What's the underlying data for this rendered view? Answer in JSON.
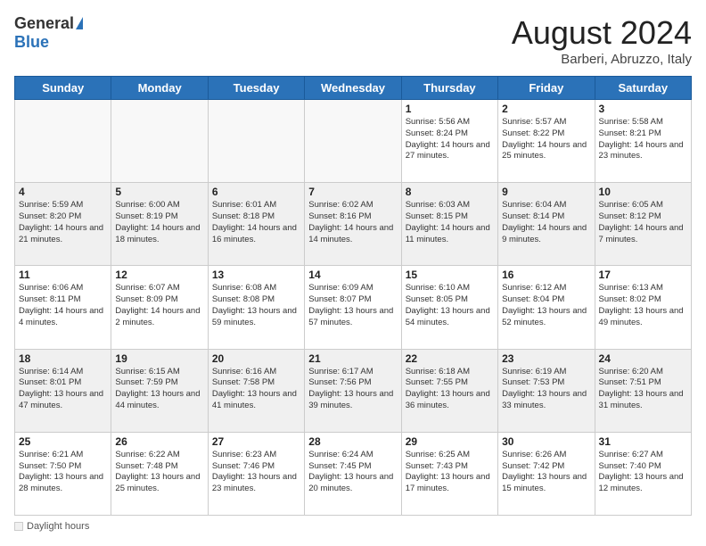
{
  "header": {
    "logo_general": "General",
    "logo_blue": "Blue",
    "month_title": "August 2024",
    "subtitle": "Barberi, Abruzzo, Italy"
  },
  "footer": {
    "label": "Daylight hours"
  },
  "weekdays": [
    "Sunday",
    "Monday",
    "Tuesday",
    "Wednesday",
    "Thursday",
    "Friday",
    "Saturday"
  ],
  "weeks": [
    [
      {
        "day": "",
        "info": ""
      },
      {
        "day": "",
        "info": ""
      },
      {
        "day": "",
        "info": ""
      },
      {
        "day": "",
        "info": ""
      },
      {
        "day": "1",
        "info": "Sunrise: 5:56 AM\nSunset: 8:24 PM\nDaylight: 14 hours and 27 minutes."
      },
      {
        "day": "2",
        "info": "Sunrise: 5:57 AM\nSunset: 8:22 PM\nDaylight: 14 hours and 25 minutes."
      },
      {
        "day": "3",
        "info": "Sunrise: 5:58 AM\nSunset: 8:21 PM\nDaylight: 14 hours and 23 minutes."
      }
    ],
    [
      {
        "day": "4",
        "info": "Sunrise: 5:59 AM\nSunset: 8:20 PM\nDaylight: 14 hours and 21 minutes."
      },
      {
        "day": "5",
        "info": "Sunrise: 6:00 AM\nSunset: 8:19 PM\nDaylight: 14 hours and 18 minutes."
      },
      {
        "day": "6",
        "info": "Sunrise: 6:01 AM\nSunset: 8:18 PM\nDaylight: 14 hours and 16 minutes."
      },
      {
        "day": "7",
        "info": "Sunrise: 6:02 AM\nSunset: 8:16 PM\nDaylight: 14 hours and 14 minutes."
      },
      {
        "day": "8",
        "info": "Sunrise: 6:03 AM\nSunset: 8:15 PM\nDaylight: 14 hours and 11 minutes."
      },
      {
        "day": "9",
        "info": "Sunrise: 6:04 AM\nSunset: 8:14 PM\nDaylight: 14 hours and 9 minutes."
      },
      {
        "day": "10",
        "info": "Sunrise: 6:05 AM\nSunset: 8:12 PM\nDaylight: 14 hours and 7 minutes."
      }
    ],
    [
      {
        "day": "11",
        "info": "Sunrise: 6:06 AM\nSunset: 8:11 PM\nDaylight: 14 hours and 4 minutes."
      },
      {
        "day": "12",
        "info": "Sunrise: 6:07 AM\nSunset: 8:09 PM\nDaylight: 14 hours and 2 minutes."
      },
      {
        "day": "13",
        "info": "Sunrise: 6:08 AM\nSunset: 8:08 PM\nDaylight: 13 hours and 59 minutes."
      },
      {
        "day": "14",
        "info": "Sunrise: 6:09 AM\nSunset: 8:07 PM\nDaylight: 13 hours and 57 minutes."
      },
      {
        "day": "15",
        "info": "Sunrise: 6:10 AM\nSunset: 8:05 PM\nDaylight: 13 hours and 54 minutes."
      },
      {
        "day": "16",
        "info": "Sunrise: 6:12 AM\nSunset: 8:04 PM\nDaylight: 13 hours and 52 minutes."
      },
      {
        "day": "17",
        "info": "Sunrise: 6:13 AM\nSunset: 8:02 PM\nDaylight: 13 hours and 49 minutes."
      }
    ],
    [
      {
        "day": "18",
        "info": "Sunrise: 6:14 AM\nSunset: 8:01 PM\nDaylight: 13 hours and 47 minutes."
      },
      {
        "day": "19",
        "info": "Sunrise: 6:15 AM\nSunset: 7:59 PM\nDaylight: 13 hours and 44 minutes."
      },
      {
        "day": "20",
        "info": "Sunrise: 6:16 AM\nSunset: 7:58 PM\nDaylight: 13 hours and 41 minutes."
      },
      {
        "day": "21",
        "info": "Sunrise: 6:17 AM\nSunset: 7:56 PM\nDaylight: 13 hours and 39 minutes."
      },
      {
        "day": "22",
        "info": "Sunrise: 6:18 AM\nSunset: 7:55 PM\nDaylight: 13 hours and 36 minutes."
      },
      {
        "day": "23",
        "info": "Sunrise: 6:19 AM\nSunset: 7:53 PM\nDaylight: 13 hours and 33 minutes."
      },
      {
        "day": "24",
        "info": "Sunrise: 6:20 AM\nSunset: 7:51 PM\nDaylight: 13 hours and 31 minutes."
      }
    ],
    [
      {
        "day": "25",
        "info": "Sunrise: 6:21 AM\nSunset: 7:50 PM\nDaylight: 13 hours and 28 minutes."
      },
      {
        "day": "26",
        "info": "Sunrise: 6:22 AM\nSunset: 7:48 PM\nDaylight: 13 hours and 25 minutes."
      },
      {
        "day": "27",
        "info": "Sunrise: 6:23 AM\nSunset: 7:46 PM\nDaylight: 13 hours and 23 minutes."
      },
      {
        "day": "28",
        "info": "Sunrise: 6:24 AM\nSunset: 7:45 PM\nDaylight: 13 hours and 20 minutes."
      },
      {
        "day": "29",
        "info": "Sunrise: 6:25 AM\nSunset: 7:43 PM\nDaylight: 13 hours and 17 minutes."
      },
      {
        "day": "30",
        "info": "Sunrise: 6:26 AM\nSunset: 7:42 PM\nDaylight: 13 hours and 15 minutes."
      },
      {
        "day": "31",
        "info": "Sunrise: 6:27 AM\nSunset: 7:40 PM\nDaylight: 13 hours and 12 minutes."
      }
    ]
  ]
}
